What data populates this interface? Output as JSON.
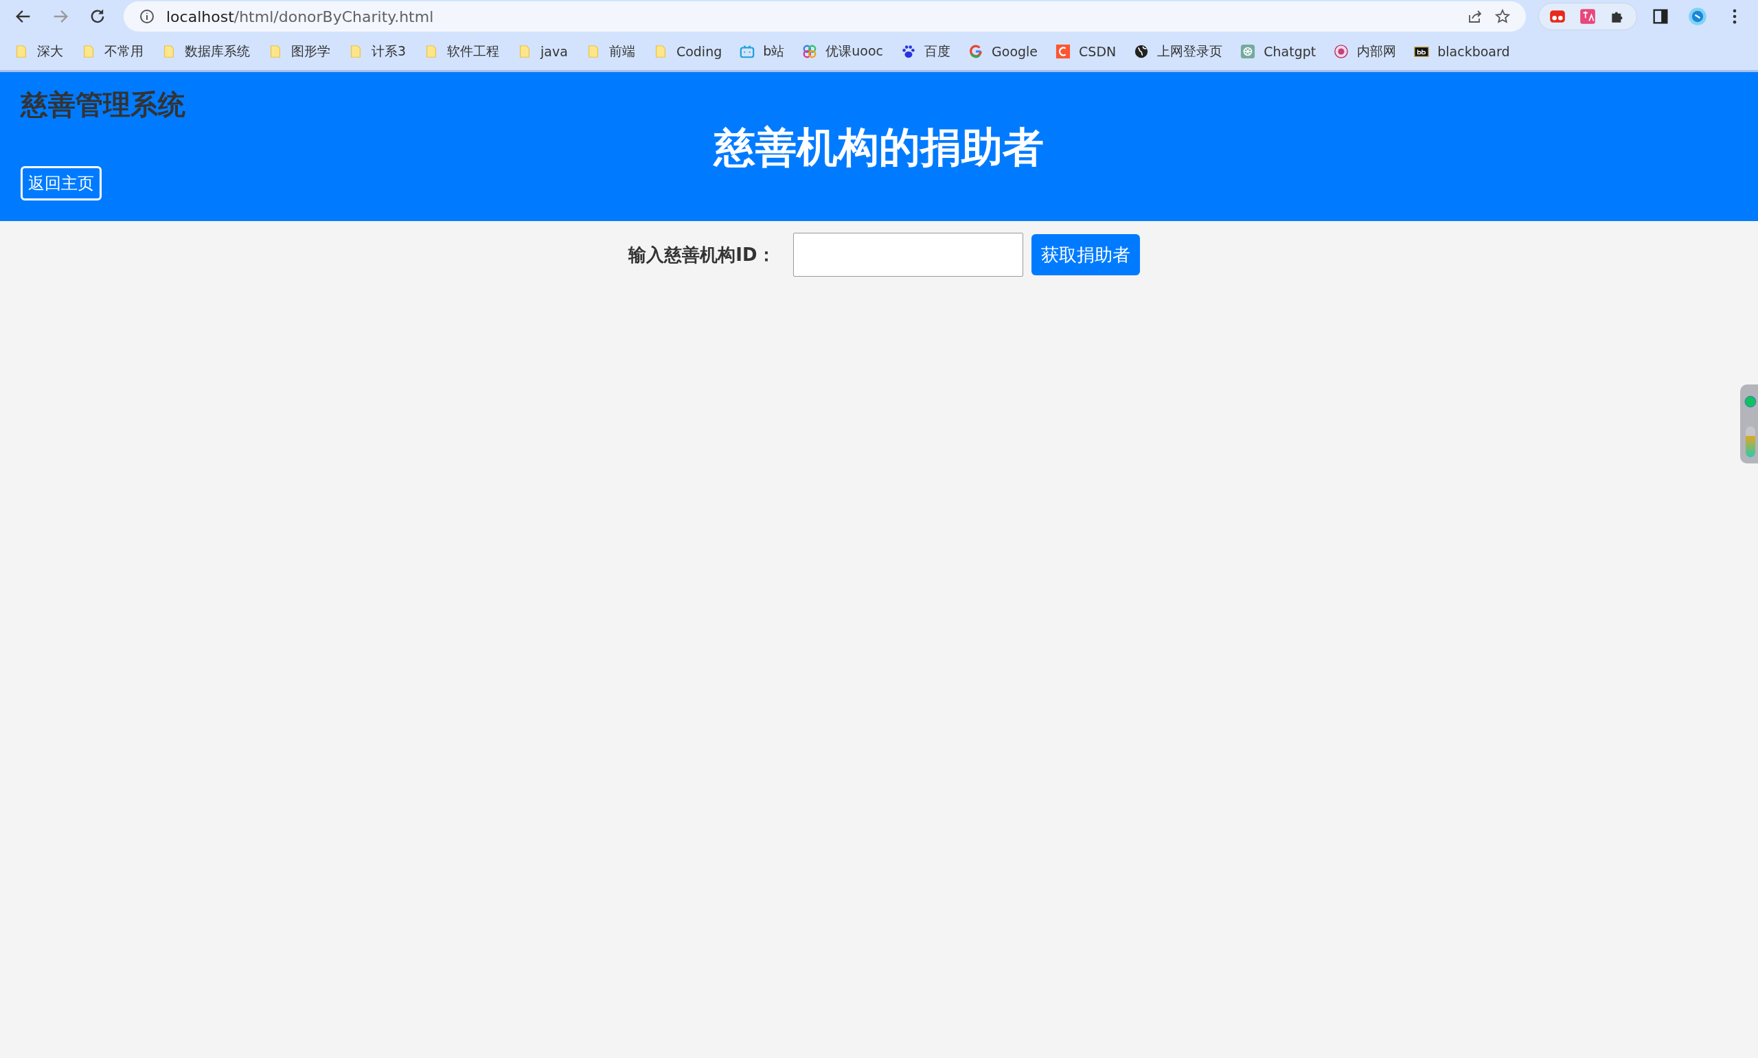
{
  "browser": {
    "address": {
      "host": "localhost",
      "path": "/html/donorByCharity.html"
    },
    "bookmarks": [
      {
        "label": "深大",
        "kind": "folder"
      },
      {
        "label": "不常用",
        "kind": "folder"
      },
      {
        "label": "数据库系统",
        "kind": "folder"
      },
      {
        "label": "图形学",
        "kind": "folder"
      },
      {
        "label": "计系3",
        "kind": "folder"
      },
      {
        "label": "软件工程",
        "kind": "folder"
      },
      {
        "label": "java",
        "kind": "folder"
      },
      {
        "label": "前端",
        "kind": "folder"
      },
      {
        "label": "Coding",
        "kind": "folder"
      },
      {
        "label": "b站",
        "kind": "tv"
      },
      {
        "label": "优课uooc",
        "kind": "rings"
      },
      {
        "label": "百度",
        "kind": "paw"
      },
      {
        "label": "Google",
        "kind": "google"
      },
      {
        "label": "CSDN",
        "kind": "letter-c"
      },
      {
        "label": "上网登录页",
        "kind": "globe"
      },
      {
        "label": "Chatgpt",
        "kind": "knot"
      },
      {
        "label": "内部网",
        "kind": "seal"
      },
      {
        "label": "blackboard",
        "kind": "bb"
      }
    ]
  },
  "header": {
    "brand": "慈善管理系统",
    "title": "慈善机构的捐助者",
    "back_button": "返回主页"
  },
  "form": {
    "label": "输入慈善机构ID：",
    "button": "获取捐助者"
  }
}
